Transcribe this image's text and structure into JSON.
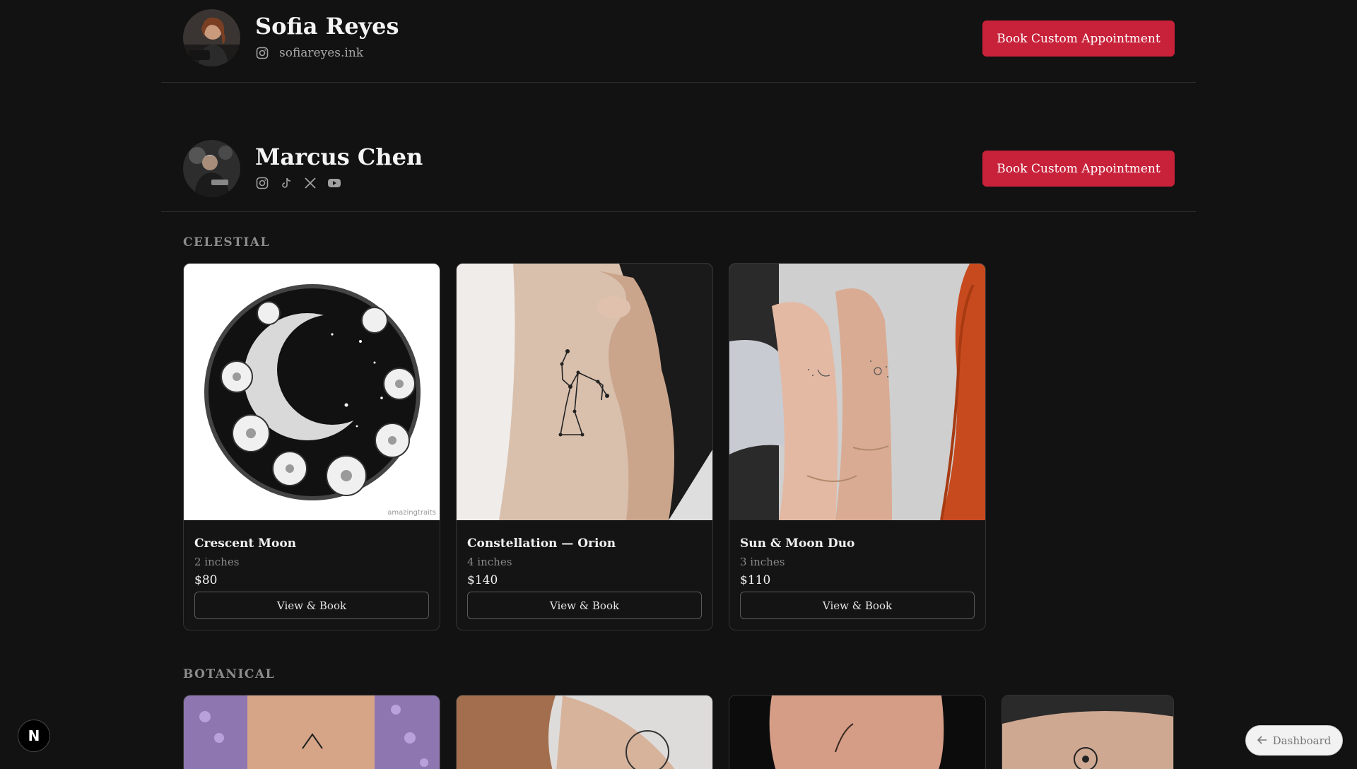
{
  "artists": [
    {
      "name": "Sofia Reyes",
      "handle": "sofiareyes.ink",
      "book_label": "Book Custom Appointment"
    },
    {
      "name": "Marcus Chen",
      "book_label": "Book Custom Appointment",
      "socials": [
        "instagram-icon",
        "tiktok-icon",
        "x-icon",
        "youtube-icon"
      ]
    }
  ],
  "categories": [
    {
      "label": "CELESTIAL",
      "items": [
        {
          "title": "Crescent Moon",
          "size": "2 inches",
          "price": "$80",
          "button": "View & Book",
          "watermark": "amazingtraits"
        },
        {
          "title": "Constellation — Orion",
          "size": "4 inches",
          "price": "$140",
          "button": "View & Book"
        },
        {
          "title": "Sun & Moon Duo",
          "size": "3 inches",
          "price": "$110",
          "button": "View & Book"
        }
      ]
    },
    {
      "label": "BOTANICAL"
    }
  ],
  "next_badge": "N",
  "dashboard_label": "Dashboard",
  "colors": {
    "accent": "#c8213a",
    "background": "#121212"
  }
}
